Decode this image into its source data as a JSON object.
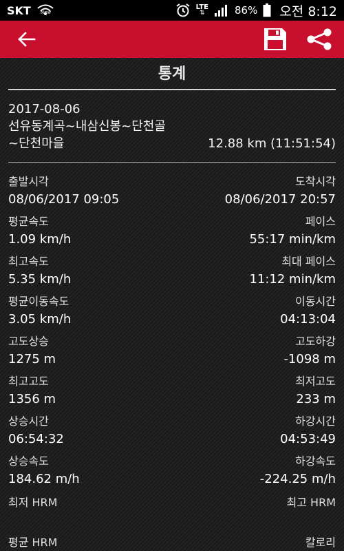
{
  "status_bar": {
    "carrier": "SKT",
    "network_badge": "New",
    "lte": "LTE",
    "battery": "86%",
    "time": "오전 8:12"
  },
  "app_bar": {
    "color": "#c8102e",
    "back_icon": "arrow-left-icon",
    "save_icon": "floppy-disk-icon",
    "share_icon": "share-icon"
  },
  "page": {
    "title": "통계"
  },
  "summary": {
    "date": "2017-08-06",
    "route_line1": "선유동계곡~내삼신봉~단천골",
    "route_line2": "~단천마을",
    "distance_duration": "12.88 km (11:51:54)"
  },
  "stats": [
    {
      "left_label": "출발시각",
      "left_value": "08/06/2017 09:05",
      "right_label": "도착시각",
      "right_value": "08/06/2017 20:57"
    },
    {
      "left_label": "평균속도",
      "left_value": "1.09 km/h",
      "right_label": "페이스",
      "right_value": "55:17 min/km"
    },
    {
      "left_label": "최고속도",
      "left_value": "5.35 km/h",
      "right_label": "최대 페이스",
      "right_value": "11:12 min/km"
    },
    {
      "left_label": "평균이동속도",
      "left_value": "3.05 km/h",
      "right_label": "이동시간",
      "right_value": "04:13:04"
    },
    {
      "left_label": "고도상승",
      "left_value": "1275 m",
      "right_label": "고도하강",
      "right_value": "-1098 m"
    },
    {
      "left_label": "최고고도",
      "left_value": "1356 m",
      "right_label": "최저고도",
      "right_value": "233 m"
    },
    {
      "left_label": "상승시간",
      "left_value": "06:54:32",
      "right_label": "하강시간",
      "right_value": "04:53:49"
    },
    {
      "left_label": "상승속도",
      "left_value": "184.62 m/h",
      "right_label": "하강속도",
      "right_value": "-224.25 m/h"
    },
    {
      "left_label": "최저 HRM",
      "left_value": "",
      "right_label": "최고 HRM",
      "right_value": ""
    },
    {
      "left_label": "평균 HRM",
      "left_value": "",
      "right_label": "칼로리",
      "right_value": ""
    }
  ]
}
